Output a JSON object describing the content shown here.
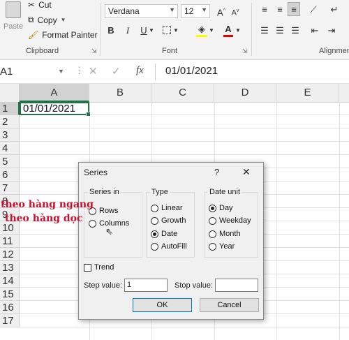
{
  "ribbon": {
    "clipboard": {
      "paste": "Paste",
      "cut": "Cut",
      "copy": "Copy",
      "format_painter": "Format Painter",
      "label": "Clipboard"
    },
    "font": {
      "name": "Verdana",
      "size": "12",
      "bold": "B",
      "italic": "I",
      "underline": "U",
      "label": "Font"
    },
    "alignment": {
      "label": "Alignment"
    }
  },
  "formula_bar": {
    "name_box": "A1",
    "fx": "fx",
    "value": "01/01/2021"
  },
  "columns": [
    "A",
    "B",
    "C",
    "D",
    "E"
  ],
  "rows": [
    "1",
    "2",
    "3",
    "4",
    "5",
    "6",
    "7",
    "8",
    "9",
    "10",
    "11",
    "12",
    "13",
    "14",
    "15",
    "16",
    "17"
  ],
  "cells": {
    "A1": "01/01/2021"
  },
  "dialog": {
    "title": "Series",
    "help": "?",
    "close": "✕",
    "series_in": {
      "label": "Series in",
      "rows": "Rows",
      "columns": "Columns"
    },
    "type": {
      "label": "Type",
      "linear": "Linear",
      "growth": "Growth",
      "date": "Date",
      "autofill": "AutoFill"
    },
    "date_unit": {
      "label": "Date unit",
      "day": "Day",
      "weekday": "Weekday",
      "month": "Month",
      "year": "Year"
    },
    "trend": "Trend",
    "step_label": "Step value:",
    "step_value": "1",
    "stop_label": "Stop value:",
    "stop_value": "",
    "ok": "OK",
    "cancel": "Cancel"
  },
  "annotations": {
    "horizontal": "theo hàng ngang",
    "vertical": "theo hàng dọc"
  },
  "colors": {
    "active_cell": "#217346",
    "annotation": "#c8102e"
  }
}
